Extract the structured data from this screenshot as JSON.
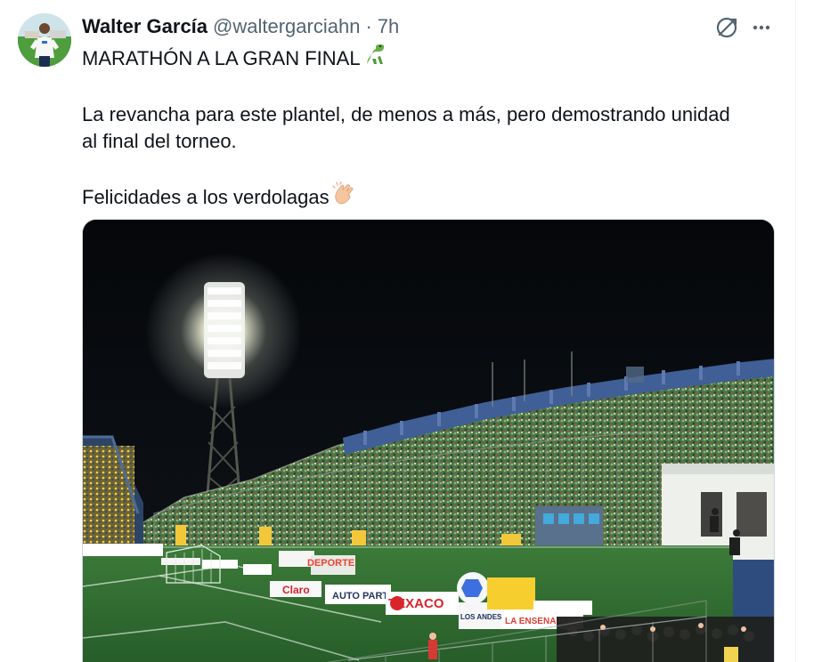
{
  "tweet": {
    "author_name": "Walter García",
    "author_handle": "@waltergarciahn",
    "separator": "·",
    "time": "7h",
    "lines": [
      "MARATHÓN A LA GRAN FINAL",
      "La revancha para este plantel, de menos a más, pero demostrando unidad",
      "al final del torneo.",
      "Felicidades a los verdolagas"
    ],
    "emojis": [
      "dinosaur-emoji",
      "clapping-hands-emoji"
    ]
  },
  "actions": {
    "grok_icon": "grok-icon",
    "more_icon": "more-options-icon"
  },
  "media": {
    "description": "stadium-night-photo",
    "signage": [
      "DEPORTE",
      "Claro",
      "AUTO PARTS",
      "TEXACO",
      "LA ENSENADA",
      "LOS ANDES"
    ]
  },
  "colors": {
    "text": "#0f1419",
    "secondary": "#536471",
    "border": "#cfd9de",
    "pitch": "#2f6a2e",
    "crowd_green": "#3e7e42"
  }
}
